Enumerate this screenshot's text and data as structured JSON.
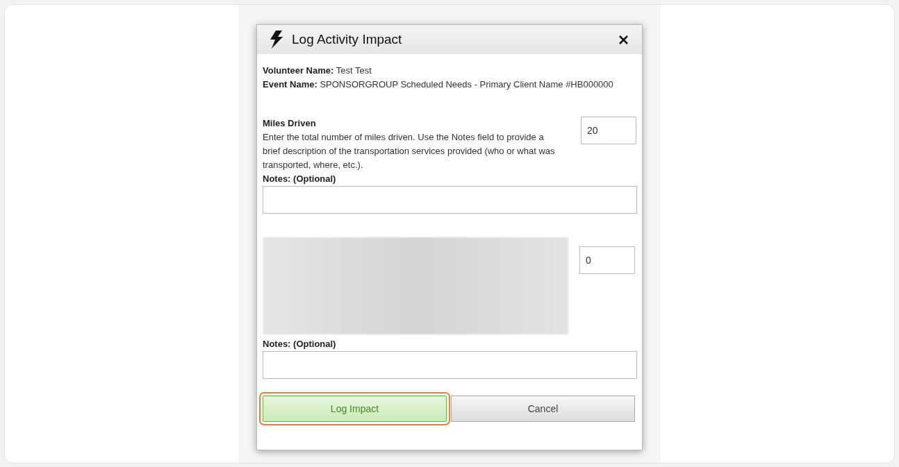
{
  "dialog": {
    "title": "Log Activity Impact",
    "info": [
      {
        "label": "Volunteer Name:",
        "value": "Test Test"
      },
      {
        "label": "Event Name:",
        "value": "SPONSORGROUP Scheduled Needs - Primary Client Name #HB000000"
      }
    ],
    "metrics": [
      {
        "kind": "described",
        "title": "Miles Driven",
        "description": "Enter the total number of miles driven. Use the Notes field to provide a brief description of the transportation services provided (who or what was transported, where, etc.).",
        "value": "20",
        "notes_label": "Notes: (Optional)"
      },
      {
        "kind": "blurred",
        "value": "0",
        "notes_label": "Notes: (Optional)"
      }
    ],
    "buttons": [
      {
        "kind": "primary",
        "label": "Log Impact",
        "highlighted": true
      },
      {
        "kind": "secondary",
        "label": "Cancel",
        "highlighted": false
      }
    ]
  }
}
